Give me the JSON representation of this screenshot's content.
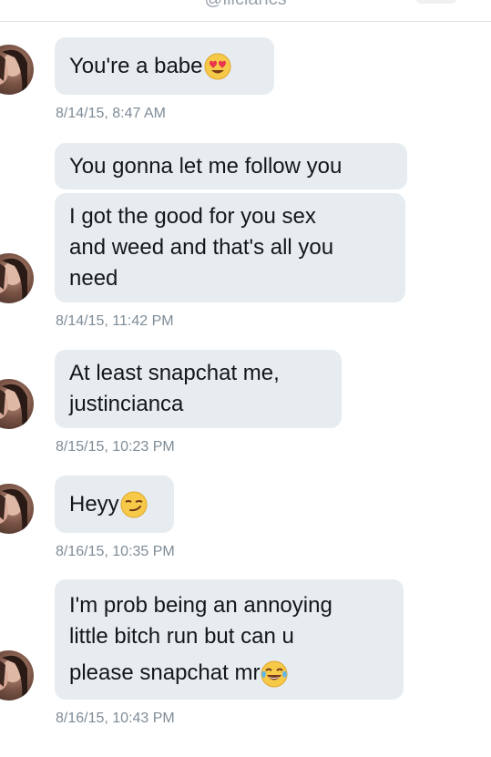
{
  "header": {
    "handle": "@iiiciancs"
  },
  "messages": [
    {
      "text": "You're a babe",
      "emoji": "heart-eyes-emoji",
      "timestamp": "8/14/15, 8:47 AM"
    },
    {
      "text": "You gonna let me follow you"
    },
    {
      "lines": [
        "I got the good for you sex",
        "and weed and that's all you",
        "need"
      ],
      "timestamp": "8/14/15, 11:42 PM"
    },
    {
      "lines": [
        "At least snapchat me,",
        "justincianca"
      ],
      "timestamp": "8/15/15, 10:23 PM"
    },
    {
      "text": "Heyy",
      "emoji": "smirk-emoji",
      "timestamp": "8/16/15, 10:35 PM"
    },
    {
      "lines": [
        "I'm prob being an annoying",
        "little bitch run but can u",
        "please snapchat mr"
      ],
      "emoji": "tears-of-joy-emoji",
      "timestamp": "8/16/15, 10:43 PM"
    }
  ],
  "colors": {
    "bubble": "#e6ecf0",
    "timestamp": "#7f8c97",
    "text": "#14171a"
  }
}
